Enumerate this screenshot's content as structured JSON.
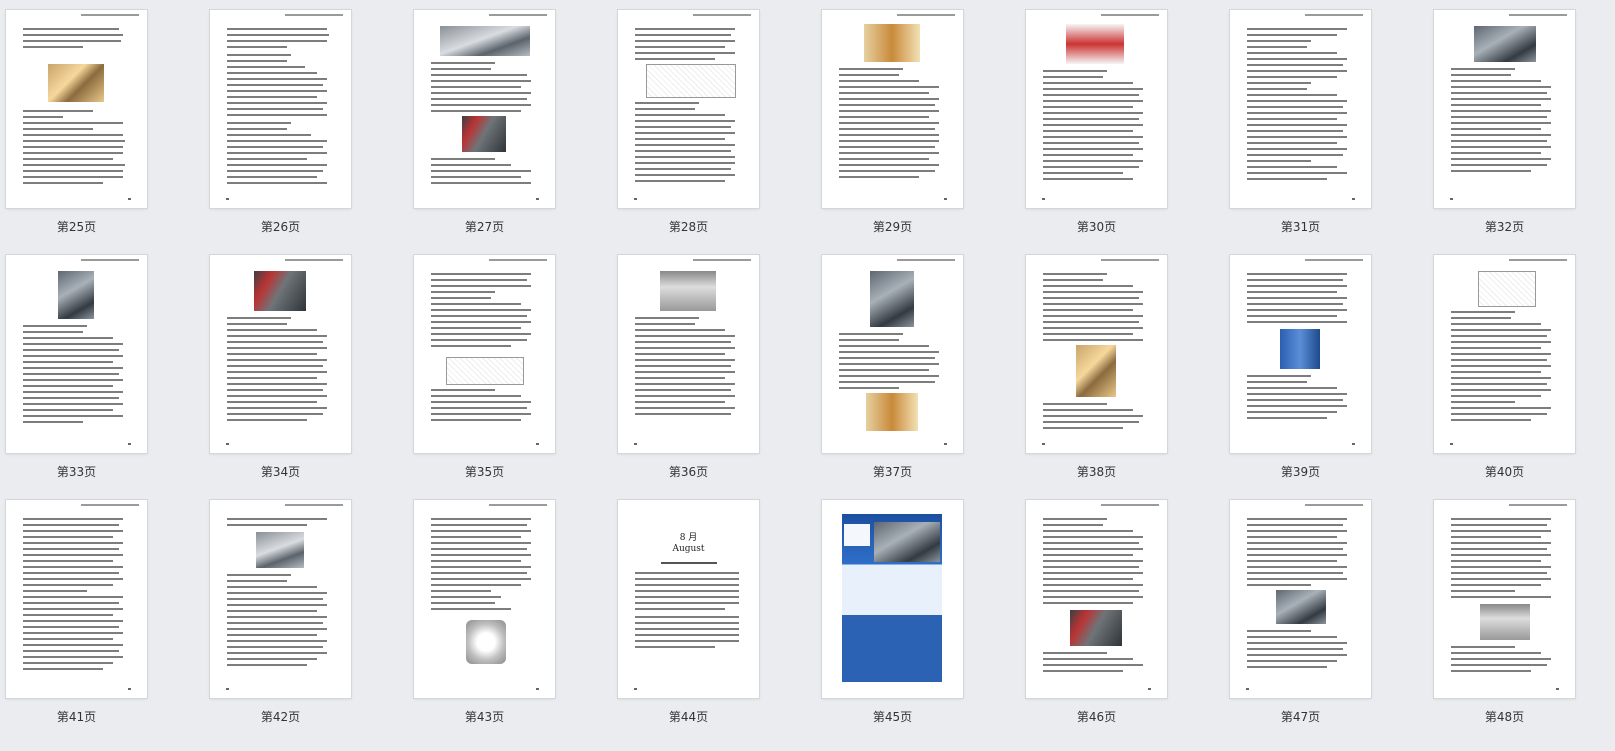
{
  "pages": [
    "第25页",
    "第26页",
    "第27页",
    "第28页",
    "第29页",
    "第30页",
    "第31页",
    "第32页",
    "第33页",
    "第34页",
    "第35页",
    "第36页",
    "第37页",
    "第38页",
    "第39页",
    "第40页",
    "第41页",
    "第42页",
    "第43页",
    "第44页",
    "第45页",
    "第46页",
    "第47页",
    "第48页"
  ],
  "page44": {
    "month": "8 月",
    "month_en": "August"
  },
  "colors": {
    "background": "#eaecf0",
    "page": "#ffffff",
    "label_text": "#333333"
  }
}
